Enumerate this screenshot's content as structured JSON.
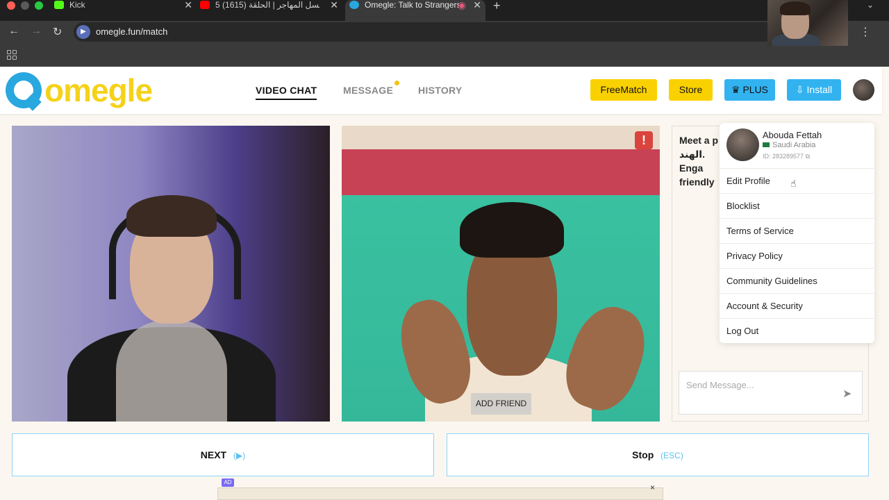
{
  "browser": {
    "tabs": [
      {
        "label": "Kick",
        "color": "#53fc18"
      },
      {
        "label": "مسلسل المهاجر | الحلقة (1615) 5",
        "color": "#ff0000"
      },
      {
        "label": "Omegle: Talk to Strangers",
        "color": "#29a7df"
      }
    ],
    "url": "omegle.fun/match"
  },
  "header": {
    "logo_text": "omegle",
    "nav": {
      "video_chat": "VIDEO CHAT",
      "message": "MESSAGE",
      "history": "HISTORY"
    },
    "buttons": {
      "freematch": "FreeMatch",
      "store": "Store",
      "plus": "PLUS",
      "install": "Install"
    }
  },
  "video": {
    "add_friend": "ADD FRIEND",
    "report": "!"
  },
  "chat": {
    "intro_lines": [
      "Meet a p",
      "الهند. Enga",
      "friendly"
    ],
    "send_placeholder": "Send Message..."
  },
  "profile_menu": {
    "name": "Abouda Fettah",
    "country": "Saudi Arabia",
    "id": "ID: 283289577",
    "items": [
      "Edit Profile",
      "Blocklist",
      "Terms of Service",
      "Privacy Policy",
      "Community Guidelines",
      "Account & Security",
      "Log Out"
    ]
  },
  "controls": {
    "next_label": "NEXT",
    "next_hint": "(▶)",
    "stop_label": "Stop",
    "stop_hint": "(ESC)"
  },
  "ad": {
    "label": "AD",
    "close": "×"
  }
}
